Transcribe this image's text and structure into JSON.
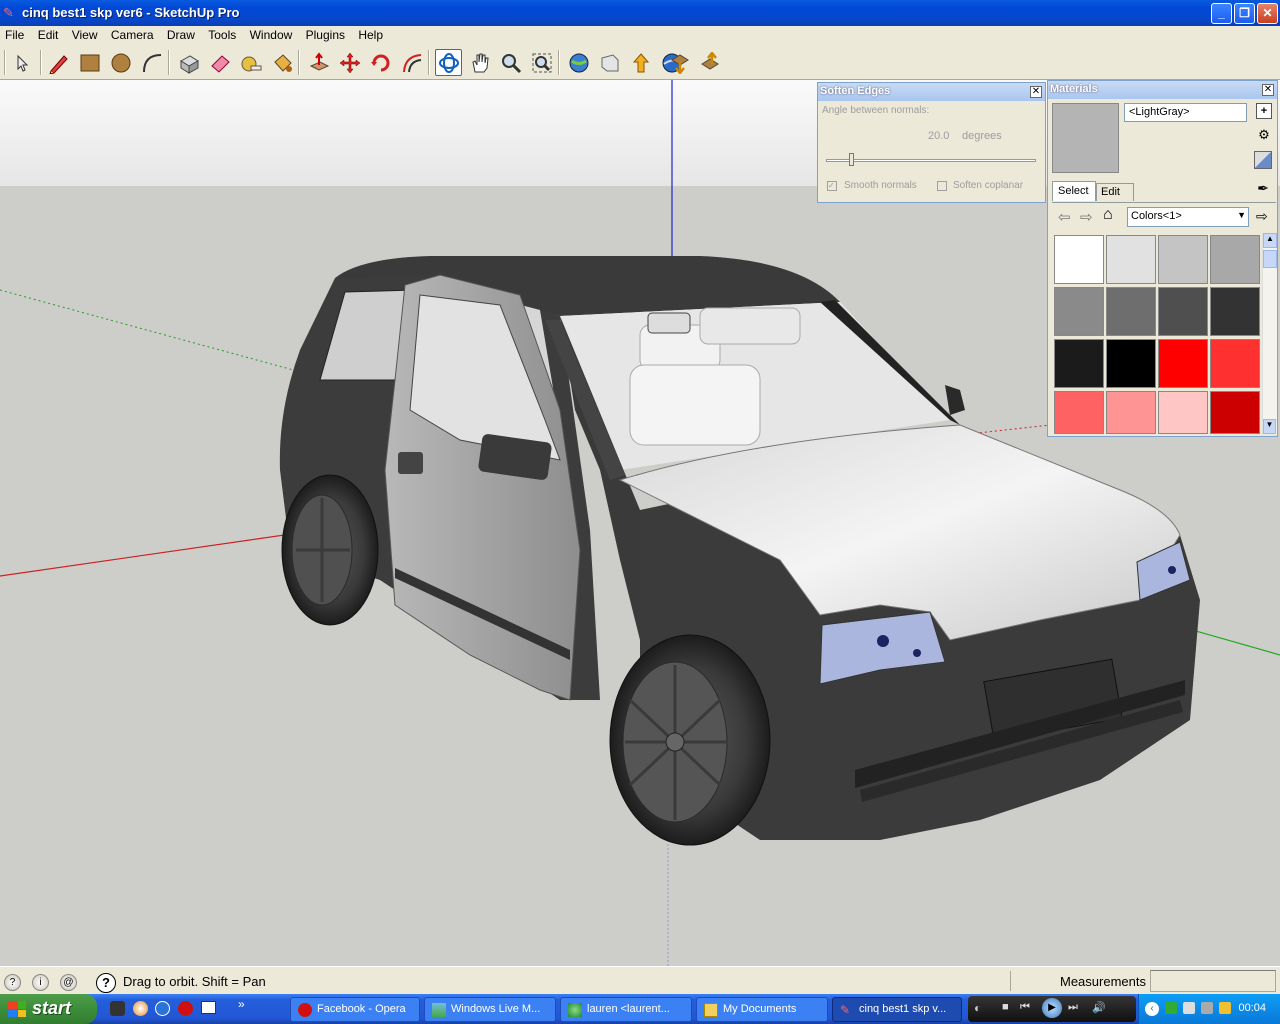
{
  "window": {
    "title": "cinq best1 skp ver6 - SketchUp Pro",
    "minimize": "_",
    "restore": "❐",
    "close": "✕"
  },
  "menu": [
    "File",
    "Edit",
    "View",
    "Camera",
    "Draw",
    "Tools",
    "Window",
    "Plugins",
    "Help"
  ],
  "toolbar_icons": [
    "select-icon",
    "pencil-icon",
    "rectangle-icon",
    "circle-icon",
    "arc-icon",
    "make-component-icon",
    "eraser-icon",
    "tape-measure-icon",
    "paint-bucket-icon",
    "push-pull-icon",
    "move-icon",
    "rotate-icon",
    "offset-icon",
    "orbit-icon",
    "pan-icon",
    "zoom-icon",
    "zoom-extents-icon",
    "get-models-icon",
    "share-model-icon",
    "share-component-icon",
    "google-earth-icon",
    "import-icon",
    "export-icon"
  ],
  "soften_edges": {
    "title": "Soften Edges",
    "angle_label": "Angle between normals:",
    "angle_value": "20.0",
    "angle_unit": "degrees",
    "slider_fraction": 0.11,
    "smooth_normals": "Smooth normals",
    "soften_coplanar": "Soften coplanar"
  },
  "materials": {
    "title": "Materials",
    "material_name": "<LightGray>",
    "tab_select": "Select",
    "tab_edit": "Edit",
    "library": "Colors<1>",
    "swatches": [
      "#ffffff",
      "#e1e1e1",
      "#c4c4c4",
      "#a8a8a8",
      "#8a8a8a",
      "#6e6e6e",
      "#4f4f4f",
      "#333333",
      "#1b1b1b",
      "#000000",
      "#ff0000",
      "#ff3030",
      "#ff6262",
      "#ff9494",
      "#ffc6c6",
      "#cc0000"
    ]
  },
  "status": {
    "hint": "Drag to orbit.  Shift = Pan",
    "measurements_label": "Measurements",
    "measurements_value": ""
  },
  "taskbar": {
    "start": "start",
    "quicklaunch_more": "»",
    "tasks": [
      {
        "label": "Facebook - Opera",
        "icon": "opera-icon",
        "active": false
      },
      {
        "label": "Windows Live M...",
        "icon": "photo-gallery-icon",
        "active": false
      },
      {
        "label": "lauren <laurent...",
        "icon": "messenger-icon",
        "active": false
      },
      {
        "label": "My Documents",
        "icon": "folder-icon",
        "active": false
      },
      {
        "label": "cinq best1 skp v...",
        "icon": "sketchup-icon",
        "active": true
      }
    ],
    "clock": "00:04"
  }
}
